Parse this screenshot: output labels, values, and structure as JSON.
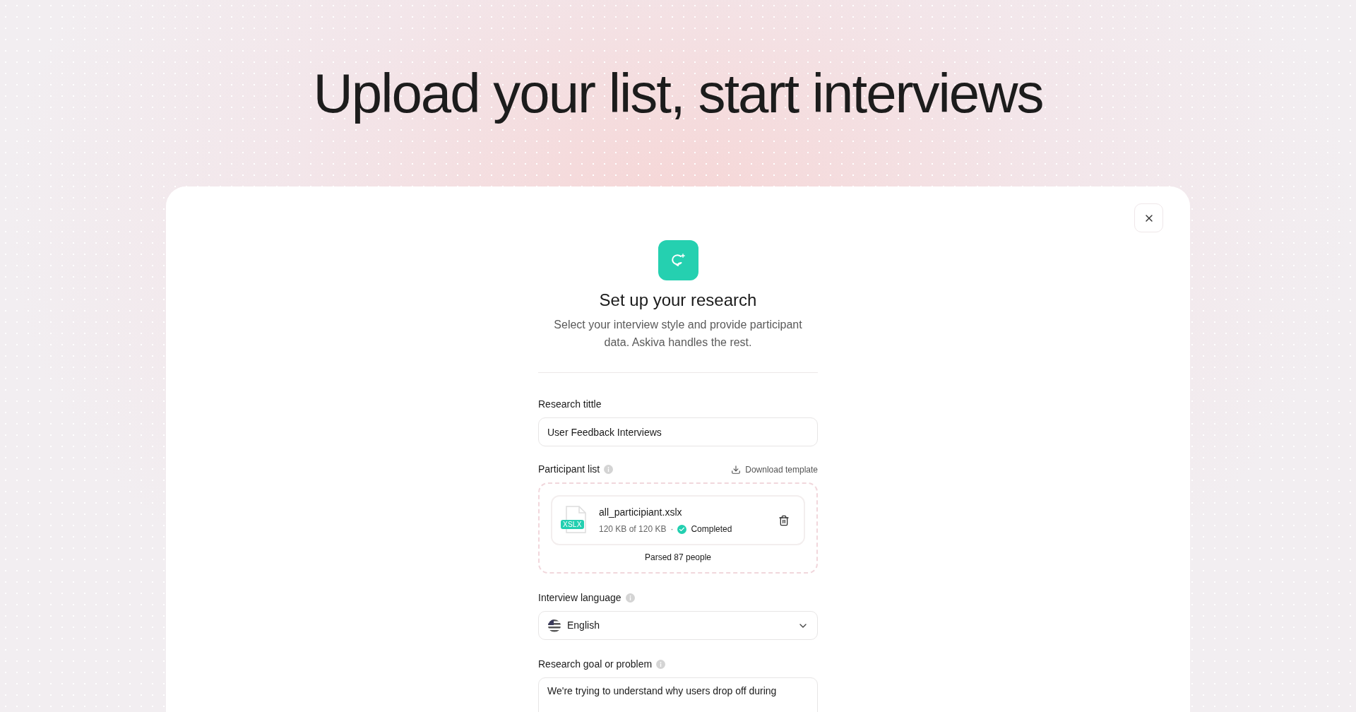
{
  "heading": "Upload your list, start interviews",
  "modal": {
    "title": "Set up your research",
    "subtitle": "Select your interview style and provide participant data. Askiva handles the rest.",
    "fields": [
      {
        "kind": "text",
        "label": "Research tittle",
        "info": false,
        "value": "User Feedback Interviews"
      },
      {
        "kind": "upload",
        "label": "Participant list",
        "info": true,
        "action": "Download template",
        "file": {
          "badge": "XSLX",
          "name": "all_participiant.xslx",
          "size": "120 KB of 120 KB",
          "separator": "·",
          "status": "Completed"
        },
        "note": "Parsed 87 people"
      },
      {
        "kind": "select",
        "label": "Interview language",
        "info": true,
        "value": "English"
      },
      {
        "kind": "textarea",
        "label": "Research goal or problem",
        "info": true,
        "value": "We're trying to understand why users drop off during"
      }
    ]
  }
}
